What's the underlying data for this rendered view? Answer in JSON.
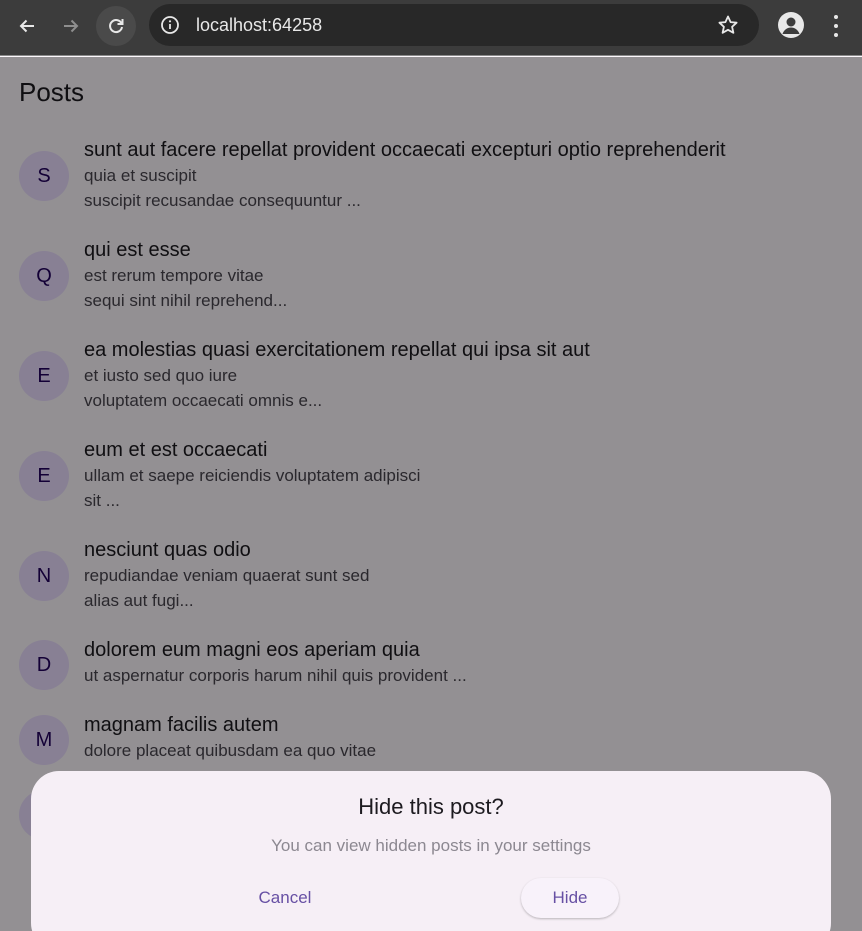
{
  "browser": {
    "url": "localhost:64258",
    "icons": [
      "back-arrow-icon",
      "forward-arrow-icon",
      "reload-icon",
      "site-info-icon",
      "bookmark-star-icon",
      "profile-icon",
      "more-menu-icon"
    ]
  },
  "app": {
    "title": "Posts",
    "posts": [
      {
        "initial": "S",
        "title": "sunt aut facere repellat provident occaecati excepturi optio reprehenderit",
        "body": "quia et suscipit\nsuscipit recusandae consequuntur ..."
      },
      {
        "initial": "Q",
        "title": "qui est esse",
        "body": "est rerum tempore vitae\nsequi sint nihil reprehend..."
      },
      {
        "initial": "E",
        "title": "ea molestias quasi exercitationem repellat qui ipsa sit aut",
        "body": "et iusto sed quo iure\nvoluptatem occaecati omnis e..."
      },
      {
        "initial": "E",
        "title": "eum et est occaecati",
        "body": "ullam et saepe reiciendis voluptatem adipisci\nsit ..."
      },
      {
        "initial": "N",
        "title": "nesciunt quas odio",
        "body": "repudiandae veniam quaerat sunt sed\nalias aut fugi..."
      },
      {
        "initial": "D",
        "title": "dolorem eum magni eos aperiam quia",
        "body": "ut aspernatur corporis harum nihil quis provident ..."
      },
      {
        "initial": "M",
        "title": "magnam facilis autem",
        "body": "dolore placeat quibusdam ea quo vitae"
      }
    ]
  },
  "dialog": {
    "title": "Hide this post?",
    "message": "You can view hidden posts in your settings",
    "cancel_label": "Cancel",
    "confirm_label": "Hide"
  },
  "colors": {
    "avatar_bg": "#eaddff",
    "avatar_fg": "#21005d",
    "accent": "#6750a4",
    "sheet_bg": "#f6eff6"
  }
}
